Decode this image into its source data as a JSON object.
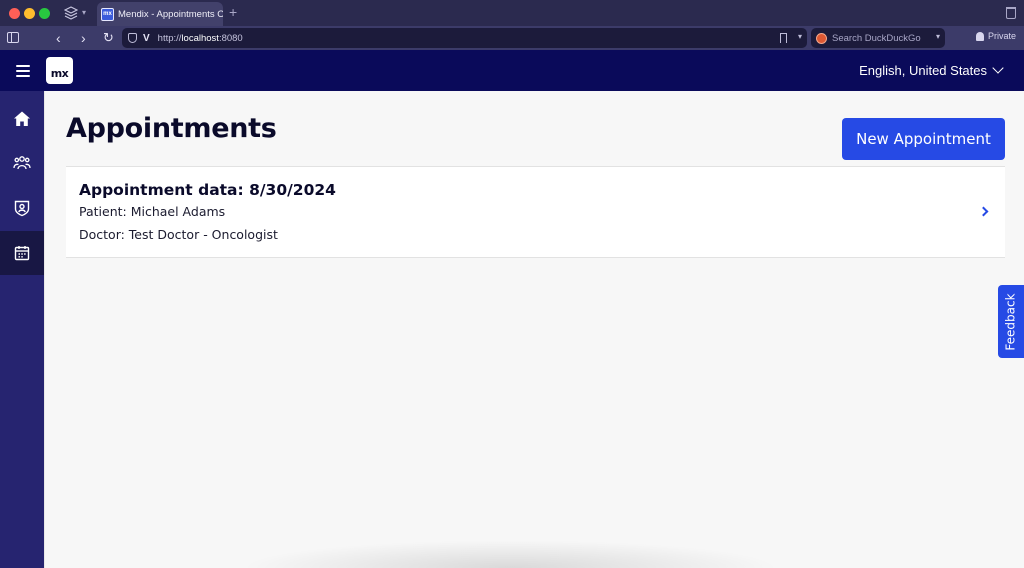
{
  "browser": {
    "tab_title": "Mendix - Appointments Ov",
    "tab_favicon_text": "mx",
    "new_tab_glyph": "+",
    "url_prefix": "http://",
    "url_host": "localhost",
    "url_port": ":8080",
    "search_placeholder": "Search DuckDuckGo",
    "private_label": "Private",
    "back_glyph": "‹",
    "forward_glyph": "›",
    "reload_glyph": "↻",
    "caret_glyph": "▾"
  },
  "app": {
    "logo_text": "mx",
    "language": "English, United States",
    "brand_color": "#0a0a5a",
    "accent_color": "#264ae5"
  },
  "sidebar": {
    "items": [
      {
        "name": "home",
        "icon": "home-icon",
        "active": false
      },
      {
        "name": "patients",
        "icon": "users-icon",
        "active": false
      },
      {
        "name": "doctors",
        "icon": "badge-shield-icon",
        "active": false
      },
      {
        "name": "appointments",
        "icon": "calendar-icon",
        "active": true
      }
    ]
  },
  "main": {
    "title": "Appointments",
    "new_button_label": "New Appointment",
    "appointments": [
      {
        "title": "Appointment data: 8/30/2024",
        "patient": "Patient: Michael Adams",
        "doctor": "Doctor: Test Doctor - Oncologist"
      }
    ]
  },
  "feedback": {
    "label": "Feedback"
  }
}
